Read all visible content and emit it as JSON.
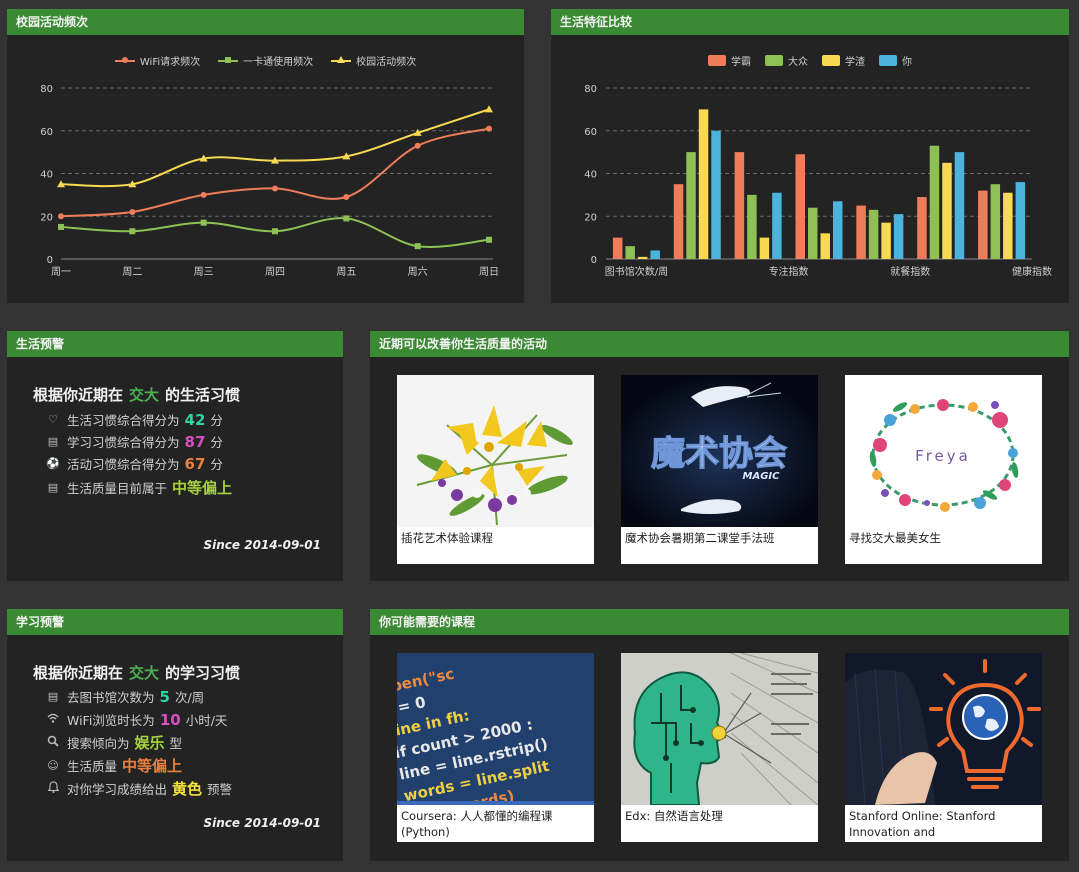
{
  "panels": {
    "campus_freq": "校园活动频次",
    "life_compare": "生活特征比较",
    "life_warning": "生活预警",
    "activities": "近期可以改善你生活质量的活动",
    "study_warning": "学习预警",
    "courses": "你可能需要的课程"
  },
  "colors": {
    "orange": "#ef7d5a",
    "green": "#8dc153",
    "yellow": "#f7d952",
    "blue": "#4ab4dc",
    "header": "#3a8a34"
  },
  "chart_data": [
    {
      "type": "line",
      "title": "",
      "categories": [
        "周一",
        "周二",
        "周三",
        "周四",
        "周五",
        "周六",
        "周日"
      ],
      "series": [
        {
          "name": "WiFi请求频次",
          "values": [
            20,
            22,
            30,
            33,
            29,
            53,
            61
          ],
          "color": "#ef7d5a",
          "marker": "circle"
        },
        {
          "name": "一卡通使用频次",
          "values": [
            15,
            13,
            17,
            13,
            19,
            6,
            9
          ],
          "color": "#8dc153",
          "marker": "square"
        },
        {
          "name": "校园活动频次",
          "values": [
            35,
            35,
            47,
            46,
            48,
            59,
            70
          ],
          "color": "#f7d952",
          "marker": "triangle"
        }
      ],
      "yticks": [
        "0",
        "20",
        "40",
        "60",
        "80"
      ],
      "ylim": [
        0,
        80
      ],
      "grid": true,
      "legend": "top-center"
    },
    {
      "type": "bar",
      "title": "",
      "categories": [
        "图书馆次数/周",
        "专注指数",
        "就餐指数",
        "健康指数"
      ],
      "series": [
        {
          "name": "学霸",
          "values": [
            10,
            35,
            50,
            49,
            25,
            29,
            32
          ],
          "color": "#ef7d5a"
        },
        {
          "name": "大众",
          "values": [
            6,
            50,
            30,
            24,
            23,
            53,
            35
          ],
          "color": "#8dc153"
        },
        {
          "name": "学渣",
          "values": [
            1,
            70,
            10,
            12,
            17,
            45,
            31
          ],
          "color": "#f7d952"
        },
        {
          "name": "你",
          "values": [
            4,
            60,
            31,
            27,
            21,
            50,
            36
          ],
          "color": "#4ab4dc"
        }
      ],
      "yticks": [
        "0",
        "20",
        "40",
        "60",
        "80"
      ],
      "ylim": [
        0,
        80
      ],
      "grid": true,
      "legend": "top-center"
    }
  ],
  "life": {
    "title_prefix": "根据你近期在",
    "school": "交大",
    "title_suffix": "的生活习惯",
    "rows": [
      {
        "icon": "heart-icon",
        "prefix": "生活习惯综合得分为",
        "value": "42",
        "suffix": "分",
        "color": "#2ad6a4"
      },
      {
        "icon": "book-icon",
        "prefix": "学习习惯综合得分为",
        "value": "87",
        "suffix": "分",
        "color": "#d94fc0"
      },
      {
        "icon": "soccer-icon",
        "prefix": "活动习惯综合得分为",
        "value": "67",
        "suffix": "分",
        "color": "#e8823e"
      },
      {
        "icon": "book-icon",
        "prefix": "生活质量目前属于",
        "value": "中等偏上",
        "suffix": "",
        "color": "#a6d23d"
      }
    ],
    "since": "Since 2014-09-01"
  },
  "study": {
    "title_prefix": "根据你近期在",
    "school": "交大",
    "title_suffix": "的学习习惯",
    "rows": [
      {
        "icon": "book-icon",
        "prefix": "去图书馆次数为",
        "value": "5",
        "suffix": "次/周",
        "color": "#2ad6a4"
      },
      {
        "icon": "wifi-icon",
        "prefix": "WiFi浏览时长为",
        "value": "10",
        "suffix": "小时/天",
        "color": "#d94fc0"
      },
      {
        "icon": "search-icon",
        "prefix": "搜索倾向为",
        "value": "娱乐",
        "suffix": "型",
        "color": "#a6d23d"
      },
      {
        "icon": "smile-icon",
        "prefix": "生活质量",
        "value": "中等偏上",
        "suffix": "",
        "color": "#e8823e"
      },
      {
        "icon": "bell-icon",
        "prefix": "对你学习成绩给出",
        "value": "黄色",
        "suffix": "预警",
        "color": "#f7e23c"
      }
    ],
    "since": "Since 2014-09-01"
  },
  "activities": [
    {
      "caption": "插花艺术体验课程",
      "image": "flower-bouquet"
    },
    {
      "caption": "魔术协会暑期第二课堂手法班",
      "image": "magic-poster",
      "art_text": "魔术协会",
      "art_sub": "MAGIC"
    },
    {
      "caption": "寻找交大最美女生",
      "image": "floral-wreath",
      "art_text": "Freya"
    }
  ],
  "courses": [
    {
      "caption": "Coursera: 人人都懂的编程课(Python)",
      "image": "python-code"
    },
    {
      "caption": "Edx: 自然语言处理",
      "image": "ai-head"
    },
    {
      "caption": "Stanford Online: Stanford Innovation and",
      "image": "lightbulb-globe"
    }
  ]
}
